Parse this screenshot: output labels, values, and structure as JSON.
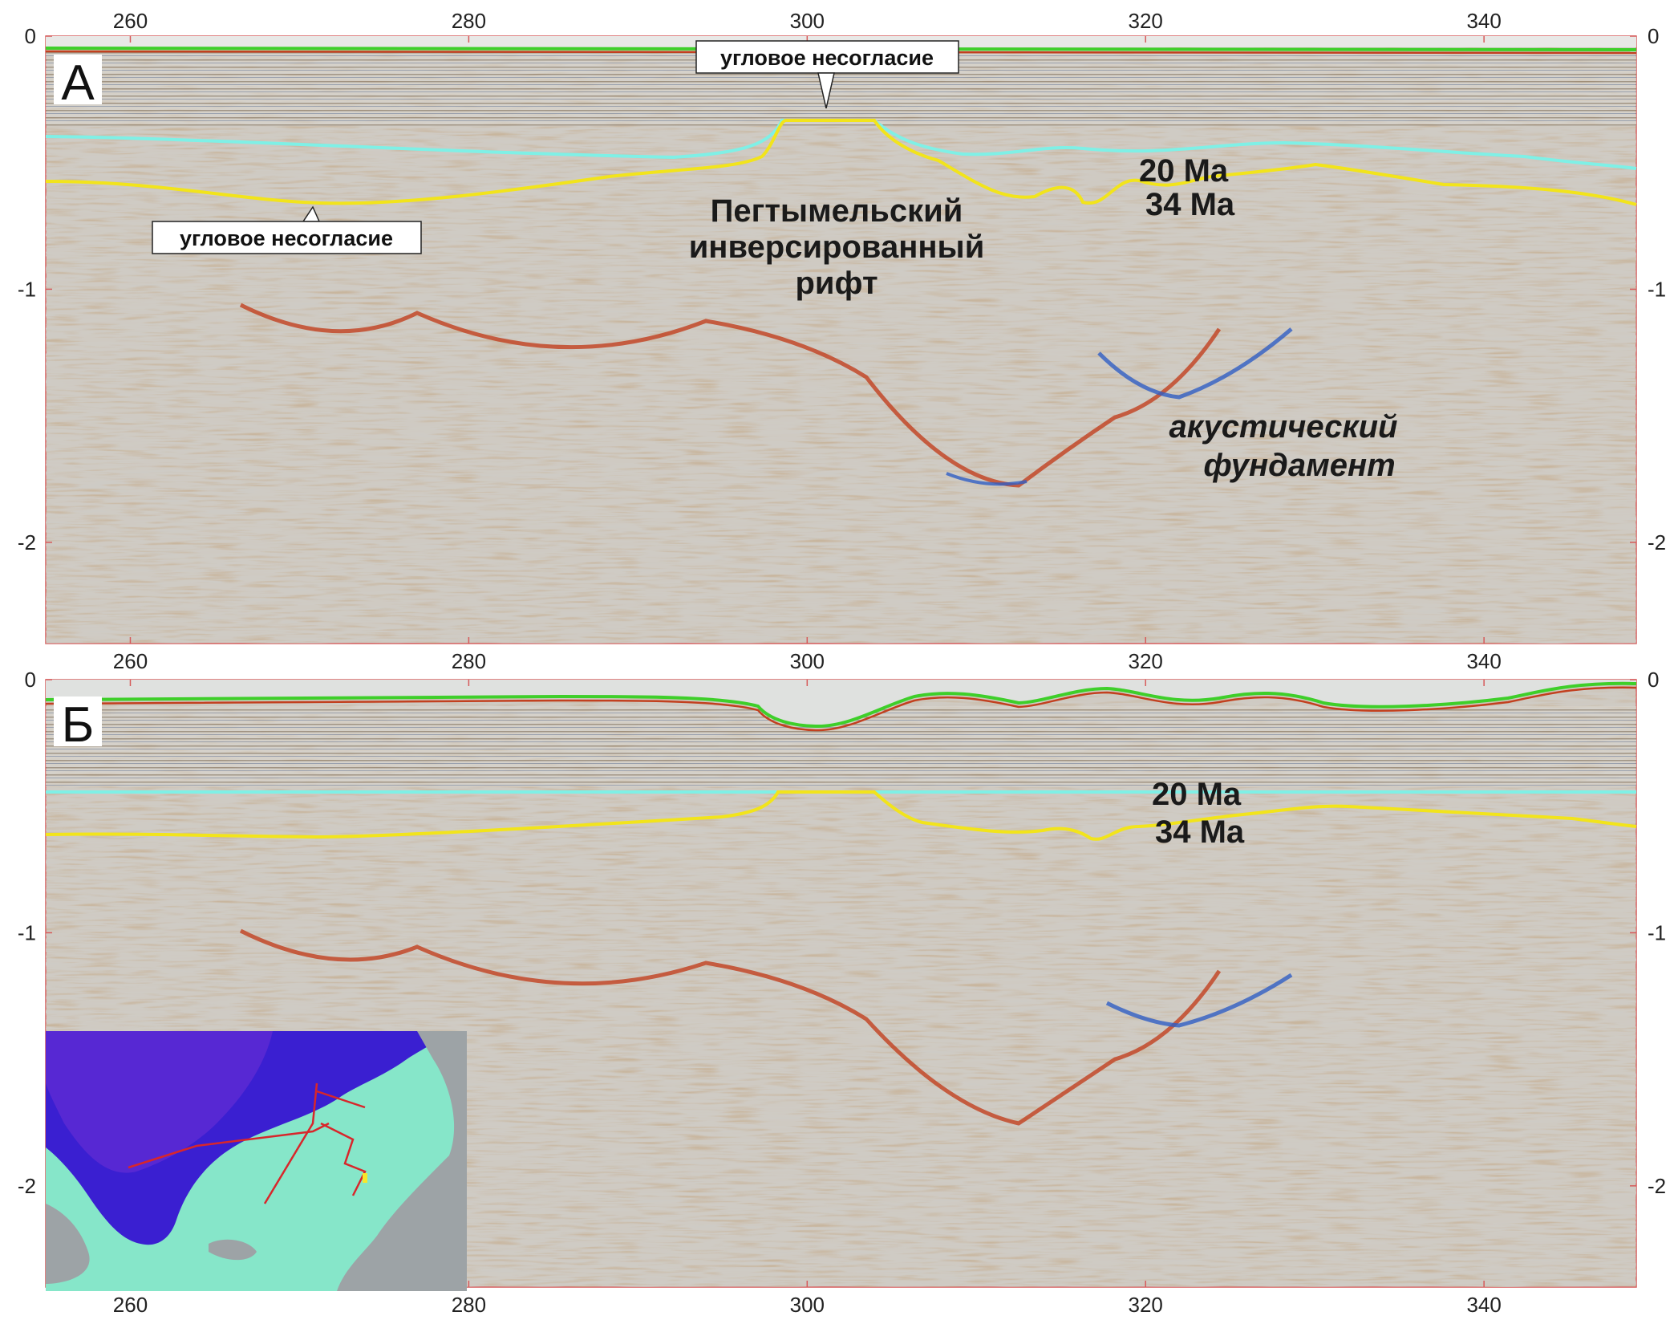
{
  "x_axis": {
    "min": 255,
    "max": 349,
    "ticks": [
      260,
      280,
      300,
      320,
      340
    ]
  },
  "y_axis": {
    "min": 0,
    "max": -2.4,
    "ticks": [
      "0",
      "-1",
      "-2"
    ]
  },
  "colors": {
    "seabed": "#3ecf2a",
    "horizon_20ma": "#7ff0e6",
    "horizon_34ma": "#f2e41b",
    "reflector_red": "#c2401f",
    "reflector_blue": "#2f5ec4",
    "frame": "#d65a5a"
  },
  "panels": [
    {
      "letter": "А",
      "callouts": [
        "угловое несогласие",
        "угловое несогласие"
      ],
      "labels": {
        "age_20": "20 Ma",
        "age_34": "34 Ma",
        "rift": [
          "Пегтымельский",
          "инверсированный",
          "рифт"
        ],
        "basement": [
          "акустический",
          "фундамент"
        ]
      }
    },
    {
      "letter": "Б",
      "labels": {
        "age_20": "20 Ma",
        "age_34": "34 Ma"
      }
    }
  ],
  "inset": {
    "content": "map",
    "colors": {
      "deep": "#3a1fd1",
      "shelf": "#86e6c9",
      "land": "#9da3a6",
      "profile": "#d8262b"
    }
  }
}
